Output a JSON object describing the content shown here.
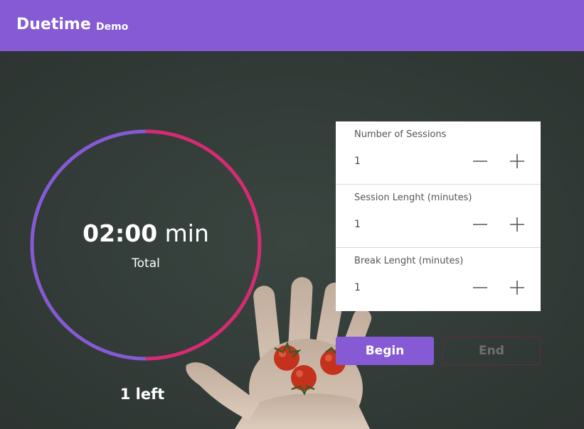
{
  "header": {
    "app_name": "Duetime",
    "subtitle": "Demo"
  },
  "timer": {
    "time_value": "02:00",
    "time_unit": "min",
    "total_label": "Total",
    "sessions_left_label": "1 left",
    "progress_fraction": 0.5
  },
  "settings": [
    {
      "label": "Number of Sessions",
      "value": "1"
    },
    {
      "label": "Session Lenght (minutes)",
      "value": "1"
    },
    {
      "label": "Break Lenght (minutes)",
      "value": "1"
    }
  ],
  "buttons": {
    "begin_label": "Begin",
    "end_label": "End"
  },
  "colors": {
    "accent": "#855ad4",
    "ring_pink": "#d62b73",
    "background": "#323a35"
  },
  "icons": {
    "minus": "minus-icon",
    "plus": "plus-icon"
  }
}
